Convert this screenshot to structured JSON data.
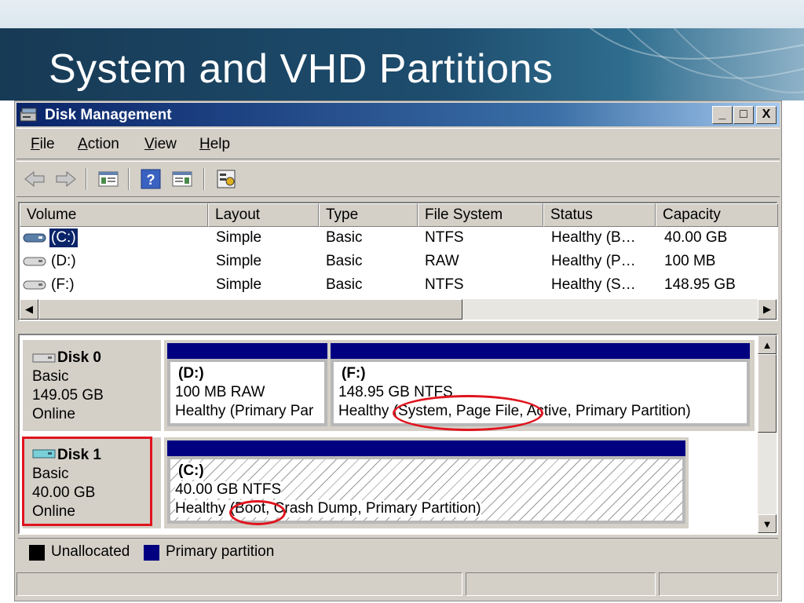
{
  "slide": {
    "title": "System and VHD Partitions"
  },
  "window": {
    "title": "Disk Management",
    "controls": {
      "minimize": "_",
      "maximize": "□",
      "close": "X"
    }
  },
  "menu": [
    {
      "accel": "F",
      "rest": "ile"
    },
    {
      "accel": "A",
      "rest": "ction"
    },
    {
      "accel": "V",
      "rest": "iew"
    },
    {
      "accel": "H",
      "rest": "elp"
    }
  ],
  "toolbar": {
    "icons": [
      "back-arrow-icon",
      "forward-arrow-icon",
      "console-tree-icon",
      "help-icon",
      "action-pane-icon",
      "properties-icon"
    ]
  },
  "volume_list": {
    "columns": [
      "Volume",
      "Layout",
      "Type",
      "File System",
      "Status",
      "Capacity"
    ],
    "rows": [
      {
        "volume": "(C:)",
        "layout": "Simple",
        "type": "Basic",
        "fs": "NTFS",
        "status": "Healthy (B…",
        "capacity": "40.00 GB"
      },
      {
        "volume": "(D:)",
        "layout": "Simple",
        "type": "Basic",
        "fs": "RAW",
        "status": "Healthy (P…",
        "capacity": "100 MB"
      },
      {
        "volume": "(F:)",
        "layout": "Simple",
        "type": "Basic",
        "fs": "NTFS",
        "status": "Healthy (S…",
        "capacity": "148.95 GB"
      }
    ]
  },
  "disks": [
    {
      "name": "Disk 0",
      "type": "Basic",
      "size": "149.05 GB",
      "state": "Online",
      "partitions": [
        {
          "label": "(D:)",
          "line1": "100 MB RAW",
          "line2": "Healthy (Primary Par"
        },
        {
          "label": "(F:)",
          "line1": "148.95 GB NTFS",
          "line2": "Healthy (System, Page File, Active, Primary Partition)"
        }
      ]
    },
    {
      "name": "Disk 1",
      "type": "Basic",
      "size": "40.00 GB",
      "state": "Online",
      "partitions": [
        {
          "label": "(C:)",
          "line1": "40.00 GB NTFS",
          "line2": "Healthy (Boot, Crash Dump, Primary Partition)"
        }
      ]
    }
  ],
  "legend": [
    {
      "label": "Unallocated",
      "color": "#000000"
    },
    {
      "label": "Primary partition",
      "color": "#000080"
    }
  ],
  "colors": {
    "annotation": "#e0141e",
    "title_bar": "#0a246a",
    "partition_bar": "#000080"
  }
}
